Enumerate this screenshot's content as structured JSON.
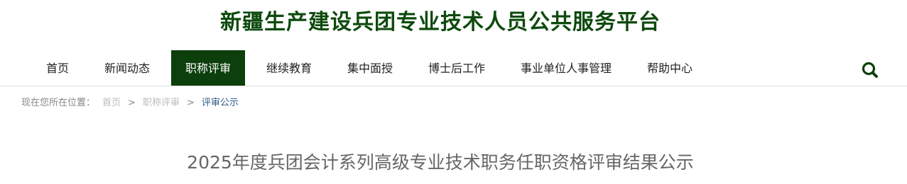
{
  "header": {
    "site_title": "新疆生产建设兵团专业技术人员公共服务平台"
  },
  "nav": {
    "items": [
      {
        "label": "首页"
      },
      {
        "label": "新闻动态"
      },
      {
        "label": "职称评审"
      },
      {
        "label": "继续教育"
      },
      {
        "label": "集中面授"
      },
      {
        "label": "博士后工作"
      },
      {
        "label": "事业单位人事管理"
      },
      {
        "label": "帮助中心"
      }
    ],
    "active_label": "职称评审",
    "search_icon": "search-icon"
  },
  "breadcrumb": {
    "prefix": "现在您所在位置：",
    "items": [
      "首页",
      "职称评审",
      "评审公示"
    ],
    "separator": ">"
  },
  "article": {
    "title": "2025年度兵团会计系列高级专业技术职务任职资格评审结果公示"
  },
  "colors": {
    "brand_green": "#0c3f0c",
    "title_green": "#0d4a0d",
    "breadcrumb_current": "#2f5a8a"
  }
}
